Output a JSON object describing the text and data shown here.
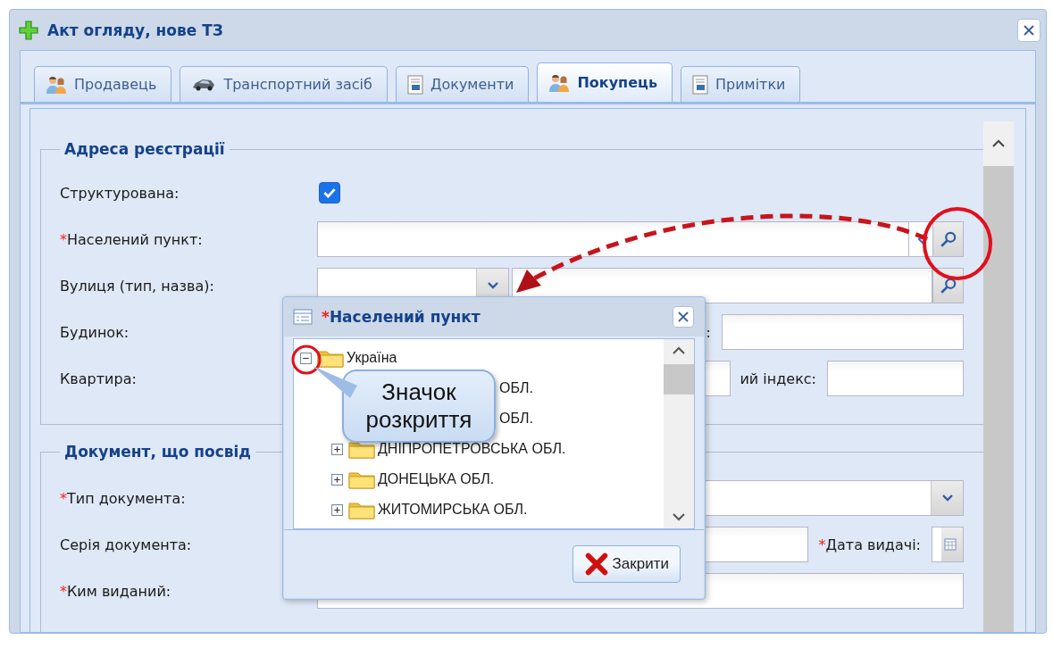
{
  "window": {
    "title": "Акт огляду, нове ТЗ"
  },
  "tabs": [
    {
      "label": "Продавець",
      "kind": "people",
      "selected": false
    },
    {
      "label": "Транспортний засіб",
      "kind": "car",
      "selected": false
    },
    {
      "label": "Документи",
      "kind": "document",
      "selected": false
    },
    {
      "label": "Покупець",
      "kind": "people",
      "selected": true
    },
    {
      "label": "Примітки",
      "kind": "document",
      "selected": false
    }
  ],
  "address": {
    "legend": "Адреса реєстрації",
    "structured": {
      "label": "Структурована:",
      "checked": true
    },
    "settlement": {
      "required_mark": "*",
      "label": "Населений пункт:"
    },
    "street": {
      "label": "Вулиця (тип, назва):"
    },
    "house": {
      "label": "Будинок:",
      "side_label": ":"
    },
    "flat": {
      "label": "Квартира:",
      "side_label": "ий індекс:"
    }
  },
  "document": {
    "legend": "Документ, що посвід",
    "type": {
      "required_mark": "*",
      "label": "Тип документа:"
    },
    "series": {
      "label": "Серія документа:",
      "side_required_mark": "*",
      "side_label": "Дата видачі:"
    },
    "issued_by": {
      "required_mark": "*",
      "label": "Ким виданий:"
    }
  },
  "popup": {
    "required_mark": "*",
    "title": "Населений пункт",
    "tree": [
      {
        "label": "Україна",
        "kind": "folder",
        "expanded": true,
        "children": [
          {
            "label": "ОБЛ.",
            "kind": "covered"
          },
          {
            "label": "ОБЛ.",
            "kind": "covered"
          },
          {
            "label": "ДНІПРОПЕТРОВСЬКА ОБЛ.",
            "kind": "folder",
            "expanded": false
          },
          {
            "label": "ДОНЕЦЬКА ОБЛ.",
            "kind": "folder",
            "expanded": false
          },
          {
            "label": "ЖИТОМИРСЬКА ОБЛ.",
            "kind": "folder",
            "expanded": false
          }
        ]
      }
    ],
    "close_button": "Закрити"
  },
  "callout": {
    "text": "Значок розкриття"
  }
}
